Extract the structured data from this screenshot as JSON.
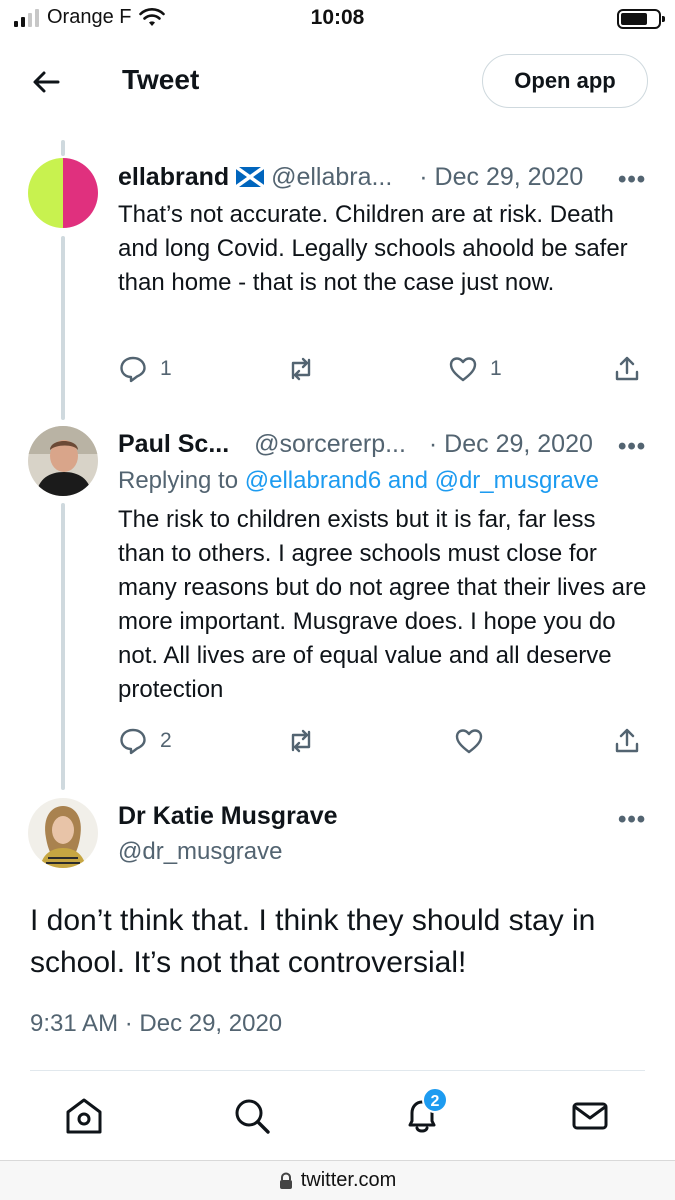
{
  "status_bar": {
    "carrier": "Orange F",
    "time": "10:08"
  },
  "header": {
    "title": "Tweet",
    "open_app": "Open app"
  },
  "tweets": [
    {
      "name": "ellabrand",
      "flag": "🏴󠁧󠁢󠁳󠁣󠁴󠁿",
      "handle": "@ellabra...",
      "date": "· Dec 29, 2020",
      "more": "•••",
      "text": "That’s not accurate. Children are at risk. Death and long Covid. Legally schools ahoold be safer than home - that is not the case just now.",
      "replies": "1",
      "likes": "1"
    },
    {
      "name": "Paul Sc...",
      "handle": "@sorcererp...",
      "date": "· Dec 29, 2020",
      "more": "•••",
      "replying_prefix": "Replying to",
      "replying_mention_1": "@ellabrand6",
      "replying_and": "and",
      "replying_mention_2": "@dr_musgrave",
      "text": "The risk to children exists but it is far, far less than to others. I agree schools must close for many reasons but do not agree that their lives are more important. Musgrave does. I hope you do not. All lives are of equal value and all deserve protection",
      "replies": "2"
    }
  ],
  "main_tweet": {
    "name": "Dr Katie Musgrave",
    "handle": "@dr_musgrave",
    "more": "•••",
    "text": "I don’t think that. I think they should stay in school. It’s not that controversial!",
    "timestamp": "9:31 AM · Dec 29, 2020"
  },
  "bottom_nav": {
    "notification_count": "2"
  },
  "url_bar": {
    "domain": "twitter.com"
  },
  "colors": {
    "accent": "#1d9bf0",
    "secondary_text": "#536471",
    "border": "#cfd9de"
  }
}
